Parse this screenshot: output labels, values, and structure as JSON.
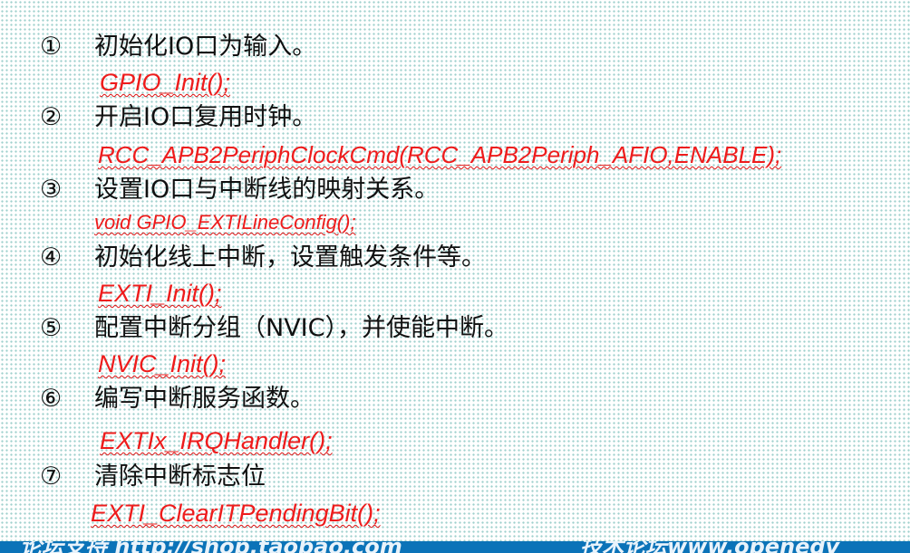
{
  "steps": [
    {
      "num": "①",
      "text": "初始化IO口为输入。",
      "code": "GPIO_Init();"
    },
    {
      "num": "②",
      "text": "开启IO口复用时钟。",
      "code": "RCC_APB2PeriphClockCmd(RCC_APB2Periph_AFIO,ENABLE);"
    },
    {
      "num": "③",
      "text": "设置IO口与中断线的映射关系。",
      "code": "void GPIO_EXTILineConfig();"
    },
    {
      "num": "④",
      "text": "初始化线上中断，设置触发条件等。",
      "code": "EXTI_Init();"
    },
    {
      "num": "⑤",
      "text": "配置中断分组（NVIC），并使能中断。",
      "code": "NVIC_Init();"
    },
    {
      "num": "⑥",
      "text": "编写中断服务函数。",
      "code": "EXTIx_IRQHandler();"
    },
    {
      "num": "⑦",
      "text": "清除中断标志位",
      "code": "EXTI_ClearITPendingBit();"
    }
  ],
  "footer": {
    "left": "论坛支持 http://shop.taobao.com",
    "right": "技术论坛www.openedv"
  },
  "colors": {
    "code": "#ee1c1c",
    "footer": "#0b73b8",
    "dots": "#9fd0cd"
  }
}
